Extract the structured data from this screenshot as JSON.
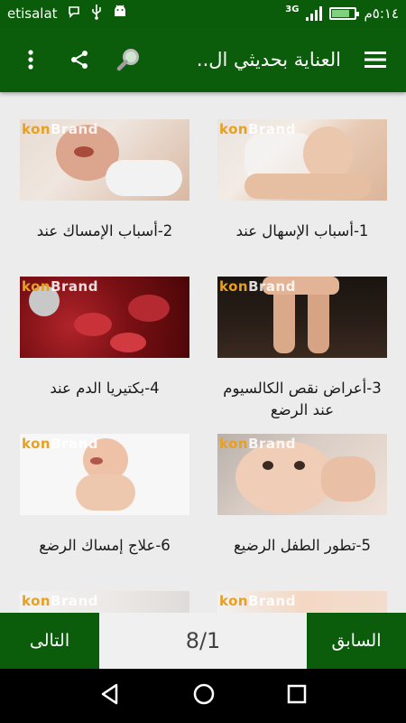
{
  "status_bar": {
    "carrier": "etisalat",
    "network": "3G",
    "time": "٥:١٤م"
  },
  "app_bar": {
    "title": "العناية بحديثي ال.."
  },
  "articles": [
    {
      "label": "1-أسباب الإسهال عند",
      "watermark_a": "kon",
      "watermark_b": "Brand"
    },
    {
      "label": "2-أسباب الإمساك عند",
      "watermark_a": "kon",
      "watermark_b": "Brand"
    },
    {
      "label": "3-أعراض نقص الكالسيوم عند الرضع",
      "watermark_a": "kon",
      "watermark_b": "Brand"
    },
    {
      "label": "4-بكتيريا الدم عند",
      "watermark_a": "kon",
      "watermark_b": "Brand"
    },
    {
      "label": "5-تطور الطفل الرضيع",
      "watermark_a": "kon",
      "watermark_b": "Brand"
    },
    {
      "label": "6-علاج إمساك الرضع",
      "watermark_a": "kon",
      "watermark_b": "Brand"
    },
    {
      "label": "",
      "watermark_a": "kon",
      "watermark_b": "Brand"
    },
    {
      "label": "",
      "watermark_a": "kon",
      "watermark_b": "Brand"
    }
  ],
  "footer": {
    "prev_label": "السابق",
    "next_label": "التالى",
    "page_indicator": "8/1"
  },
  "colors": {
    "primary": "#0b5d0b",
    "status_bar": "#0a5c0a",
    "background": "#ececec"
  }
}
